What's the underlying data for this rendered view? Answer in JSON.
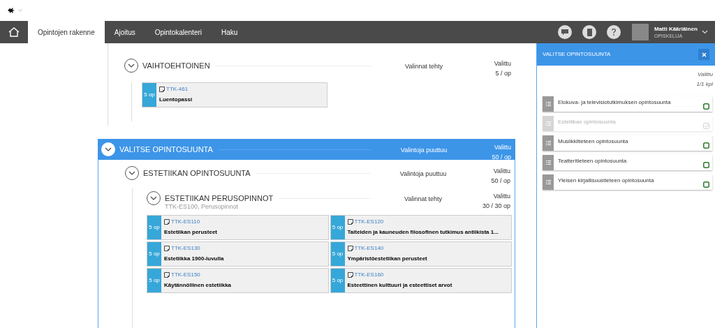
{
  "nav": {
    "tabs": [
      {
        "label": "Opintojen rakenne",
        "selected": true
      },
      {
        "label": "Ajoitus",
        "selected": false
      },
      {
        "label": "Opintokalenteri",
        "selected": false
      },
      {
        "label": "Haku",
        "selected": false
      }
    ],
    "user": {
      "name": "Matti Kääriäinen",
      "role": "OPISKELIJA"
    }
  },
  "optional_group": {
    "title": "VAIHTOEHTOINEN",
    "status": "Valinnat tehty",
    "selected_label": "Valittu",
    "credits": "5 / op",
    "courses": [
      {
        "credits": "5 op",
        "code": "TTK-461",
        "name": "Luentopassi"
      }
    ]
  },
  "selection_section": {
    "title": "VALITSE OPINTOSUUNTA",
    "status": "Valintoja puuttuu",
    "selected_label": "Valittu",
    "credits": "50 / op",
    "track": {
      "title": "ESTETIIKAN OPINTOSUUNTA",
      "status": "Valintoja puuttuu",
      "selected_label": "Valittu",
      "credits": "50 / op",
      "module": {
        "title": "ESTETIIKAN PERUSOPINNOT",
        "subtitle": "TTK-ES100, Perusopinnot",
        "status": "Valinnat tehty",
        "selected_label": "Valittu",
        "credits": "30 / 30 op",
        "courses": [
          {
            "credits": "5 op",
            "code": "TTK-ES110",
            "name": "Estetiikan perusteet"
          },
          {
            "credits": "5 op",
            "code": "TTK-ES120",
            "name": "Taiteiden ja kauneuden filosofinen tutkimus antiikista 1..."
          },
          {
            "credits": "5 op",
            "code": "TTK-ES130",
            "name": "Estetiikka 1900-luvulla"
          },
          {
            "credits": "5 op",
            "code": "TTK-ES140",
            "name": "Ympäristöestetiikan perusteet"
          },
          {
            "credits": "5 op",
            "code": "TTK-ES150",
            "name": "Käytännöllinen estetiikka"
          },
          {
            "credits": "5 op",
            "code": "TTK-ES160",
            "name": "Esteettinen kulttuuri ja esteettiset arvot"
          }
        ]
      }
    }
  },
  "panel": {
    "title": "VALITSE OPINTOSUUNTA",
    "selected_label": "Valittu",
    "count": "1/1 kpl",
    "options": [
      {
        "label": "Elokuva- ja televisiotutkimuksen opintosuunta",
        "selected": false
      },
      {
        "label": "Estetiikan opintosuunta",
        "selected": true
      },
      {
        "label": "Musiikkitieteen opintosuunta",
        "selected": false
      },
      {
        "label": "Teatteritieteen opintosuunta",
        "selected": false
      },
      {
        "label": "Yleisen kirjallisuustieteen opintosuunta",
        "selected": false
      }
    ]
  }
}
